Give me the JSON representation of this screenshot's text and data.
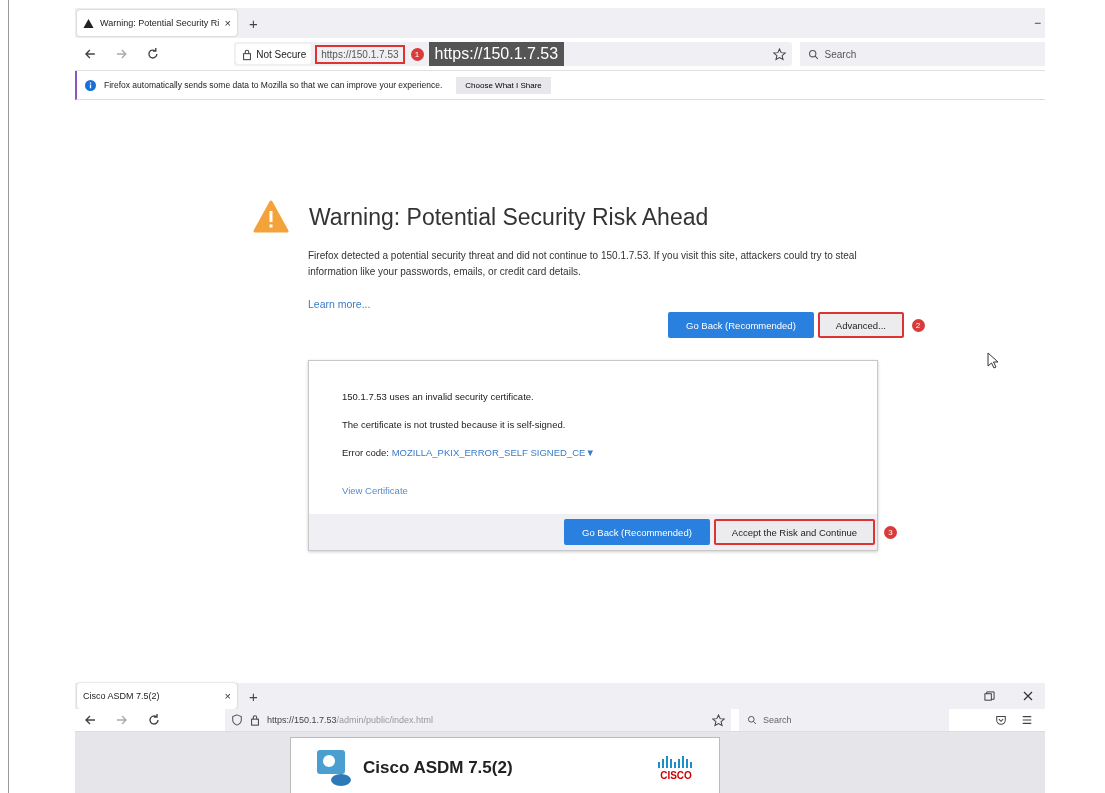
{
  "top_window": {
    "tabs": [
      {
        "title": "Warning: Potential Security Ri",
        "close": "×",
        "selected": true
      }
    ],
    "new_tab": "+",
    "minimize": "−",
    "nav": {
      "security_label": "Not Secure",
      "url": "https://150.1.7.53",
      "url_highlighted": true,
      "url_step": "1",
      "tooltip": "https://150.1.7.53",
      "search_placeholder": "Search"
    },
    "notification": {
      "text": "Firefox automatically sends some data to Mozilla so that we can improve your experience.",
      "button": "Choose What I Share"
    }
  },
  "error_page": {
    "title": "Warning: Potential Security Risk Ahead",
    "description": "Firefox detected a potential security threat and did not continue to 150.1.7.53. If you visit this site, attackers could try to steal information like your passwords, emails, or credit card details.",
    "learn_more": "Learn more...",
    "buttons": [
      {
        "label": "Go Back (Recommended)",
        "kind": "primary",
        "highlighted": false
      },
      {
        "label": "Advanced...",
        "kind": "secondary",
        "highlighted": true,
        "step": "2"
      }
    ],
    "advanced": {
      "lines": [
        "150.1.7.53 uses an invalid security certificate.",
        "The certificate is not trusted because it is self-signed."
      ],
      "error_label": "Error code:",
      "error_code": "MOZILLA_PKIX_ERROR_SELF SIGNED_CE▼",
      "view_certificate": "View Certificate",
      "buttons": [
        {
          "label": "Go Back (Recommended)",
          "kind": "primary",
          "highlighted": false
        },
        {
          "label": "Accept the Risk and Continue",
          "kind": "secondary",
          "highlighted": true,
          "step": "3"
        }
      ]
    }
  },
  "bottom_window": {
    "tabs": [
      {
        "title": "Cisco ASDM 7.5(2)",
        "close": "×",
        "selected": true
      }
    ],
    "new_tab": "+",
    "nav": {
      "url_host": "https://150.1.7.53",
      "url_path": "/admin/public/index.html",
      "search_placeholder": "Search"
    },
    "card": {
      "title": "Cisco ASDM 7.5(2)",
      "logo_text": "CISCO"
    }
  }
}
